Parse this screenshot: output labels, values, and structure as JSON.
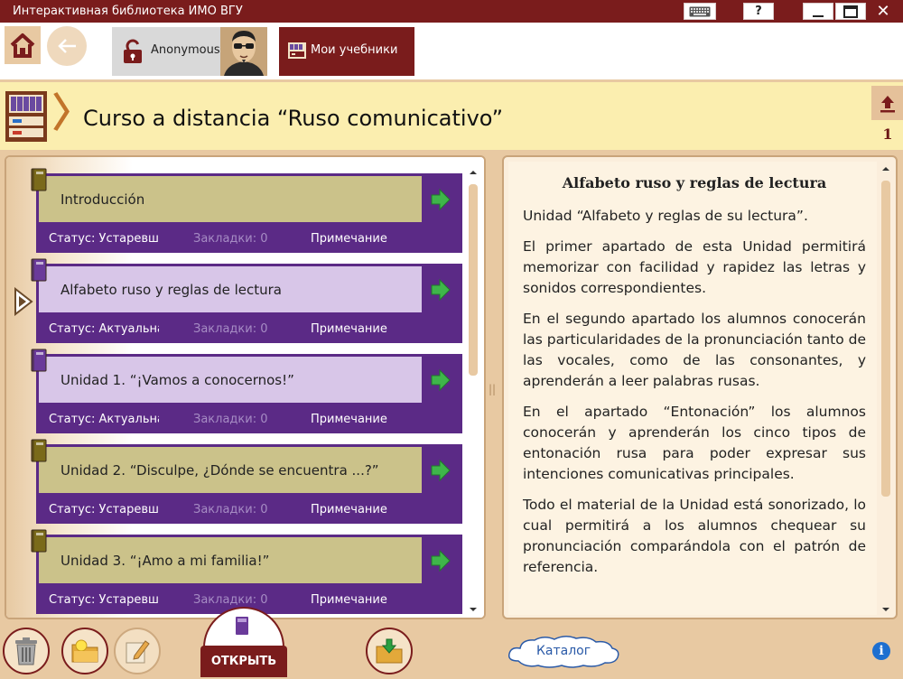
{
  "window": {
    "title": "Интерактивная библиотека ИМО ВГУ",
    "help_label": "?",
    "minimize_label": "—",
    "close_label": "✕"
  },
  "nav": {
    "back_label": "←",
    "user_name": "Anonymous",
    "books_tab_label": "Мои учебники"
  },
  "header": {
    "chevron": "〉",
    "course_title": "Curso a distancia “Ruso comunicativo”",
    "upload_count": "1"
  },
  "units": [
    {
      "title": "Introducción",
      "status": "Статус: Устаревшая",
      "bookmarks": "Закладки: 0",
      "note": "Примечание",
      "state": "old"
    },
    {
      "title": "Alfabeto ruso y reglas de lectura",
      "status": "Статус: Актуальная",
      "bookmarks": "Закладки: 0",
      "note": "Примечание",
      "state": "cur"
    },
    {
      "title": "Unidad 1. “¡Vamos a conocernos!”",
      "status": "Статус: Актуальная",
      "bookmarks": "Закладки: 0",
      "note": "Примечание",
      "state": "cur"
    },
    {
      "title": "Unidad 2. “Disculpe, ¿Dónde se encuentra ...?”",
      "status": "Статус: Устаревшая",
      "bookmarks": "Закладки: 0",
      "note": "Примечание",
      "state": "old"
    },
    {
      "title": "Unidad 3. “¡Amo a mi familia!”",
      "status": "Статус: Устаревшая",
      "bookmarks": "Закладки: 0",
      "note": "Примечание",
      "state": "old"
    }
  ],
  "description": {
    "heading": "Alfabeto ruso y reglas de lectura",
    "paragraphs": [
      "Unidad “Alfabeto y reglas de su lectura”.",
      "El primer apartado de esta Unidad permitirá memorizar con facilidad y rapidez las letras y sonidos correspondientes.",
      "En el segundo apartado los alumnos conocerán las particularidades de la pronunciación tanto de las vocales, como de las consonantes, y aprenderán a leer palabras rusas.",
      "En el apartado “Entonación” los alumnos conocerán y aprenderán los cinco tipos de entonación rusa para poder expresar sus intenciones comunicativas principales.",
      "Todo el material de la Unidad está sonorizado, lo cual permitirá a los alumnos chequear su pronunciación comparándola con el patrón de referencia."
    ]
  },
  "splitter": "||",
  "bottom": {
    "open_label": "ОТКРЫТЬ",
    "catalog_label": "Каталог",
    "info_label": "i"
  },
  "colors": {
    "accent": "#7a1c1c",
    "unit_purple": "#5b2a86",
    "unit_old": "#cbc28a",
    "unit_current": "#d8c6e8",
    "arrow_green": "#3fb54a"
  },
  "icons": {
    "home": "home-icon",
    "back": "arrow-left-icon",
    "lock": "lock-open-icon",
    "books": "bookshelf-icon",
    "upload": "upload-arrow-icon",
    "trash": "trash-icon",
    "folder_new": "folder-star-icon",
    "edit": "edit-pencil-icon",
    "download": "download-folder-icon",
    "info": "info-icon"
  }
}
